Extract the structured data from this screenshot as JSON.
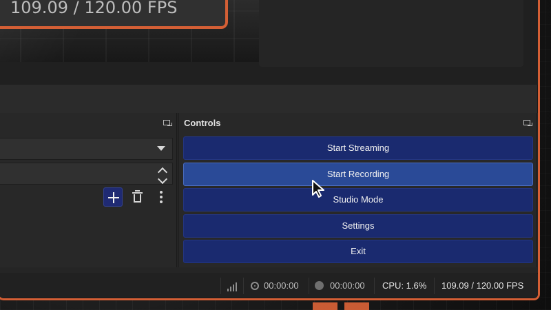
{
  "app": {
    "overlay_fps": "109.09 / 120.00 FPS"
  },
  "left_panel": {
    "icons": {
      "dock": "dock-icon",
      "dropdown": "chevron-down-icon",
      "spin_up": "chevron-up-icon",
      "spin_down": "chevron-down-icon",
      "add": "plus-icon",
      "trash": "trash-icon",
      "more": "more-vertical-icon"
    }
  },
  "controls": {
    "title": "Controls",
    "buttons": [
      {
        "label": "Start Streaming"
      },
      {
        "label": "Start Recording"
      },
      {
        "label": "Studio Mode"
      },
      {
        "label": "Settings"
      },
      {
        "label": "Exit"
      }
    ]
  },
  "status_bar": {
    "stream_time": "00:00:00",
    "record_time": "00:00:00",
    "cpu": "CPU: 1.6%",
    "fps": "109.09 / 120.00 FPS",
    "icons": {
      "signal": "signal-icon",
      "stream": "broadcast-icon",
      "record": "record-icon"
    }
  },
  "colors": {
    "accent": "#d45f35",
    "button": "#1a2a6f",
    "button_hover": "#2a4a97",
    "panel": "#282828",
    "status": "#212121"
  }
}
